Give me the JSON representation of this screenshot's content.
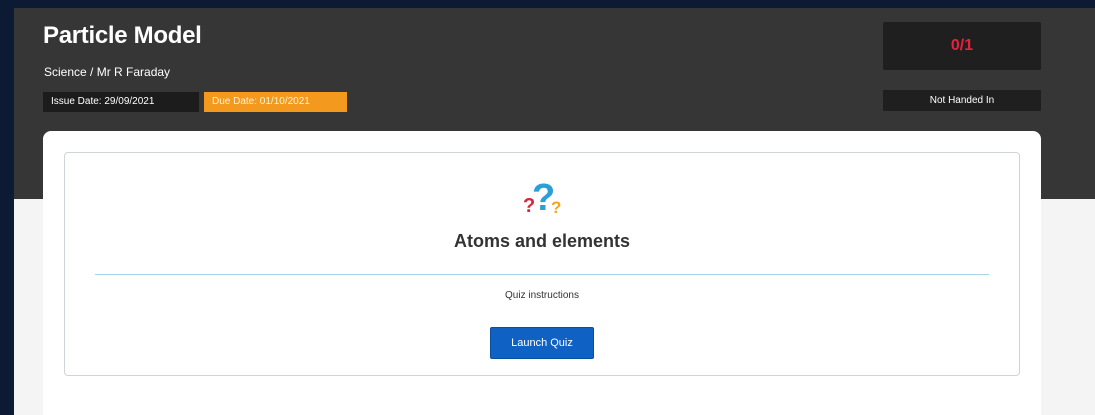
{
  "header": {
    "title": "Particle Model",
    "subtitle": "Science / Mr R Faraday",
    "issue_date": "Issue Date: 29/09/2021",
    "due_date": "Due Date: 01/10/2021",
    "score": "0/1",
    "status": "Not Handed In"
  },
  "quiz": {
    "icon": "question-marks-icon",
    "title": "Atoms and elements",
    "instructions": "Quiz instructions",
    "launch_label": "Launch Quiz"
  },
  "colors": {
    "header_background": "#363636",
    "due_date_badge": "#f39a1e",
    "score_text": "#e8203c",
    "launch_button": "#0f62c4",
    "outer_background": "#0c1a33"
  }
}
